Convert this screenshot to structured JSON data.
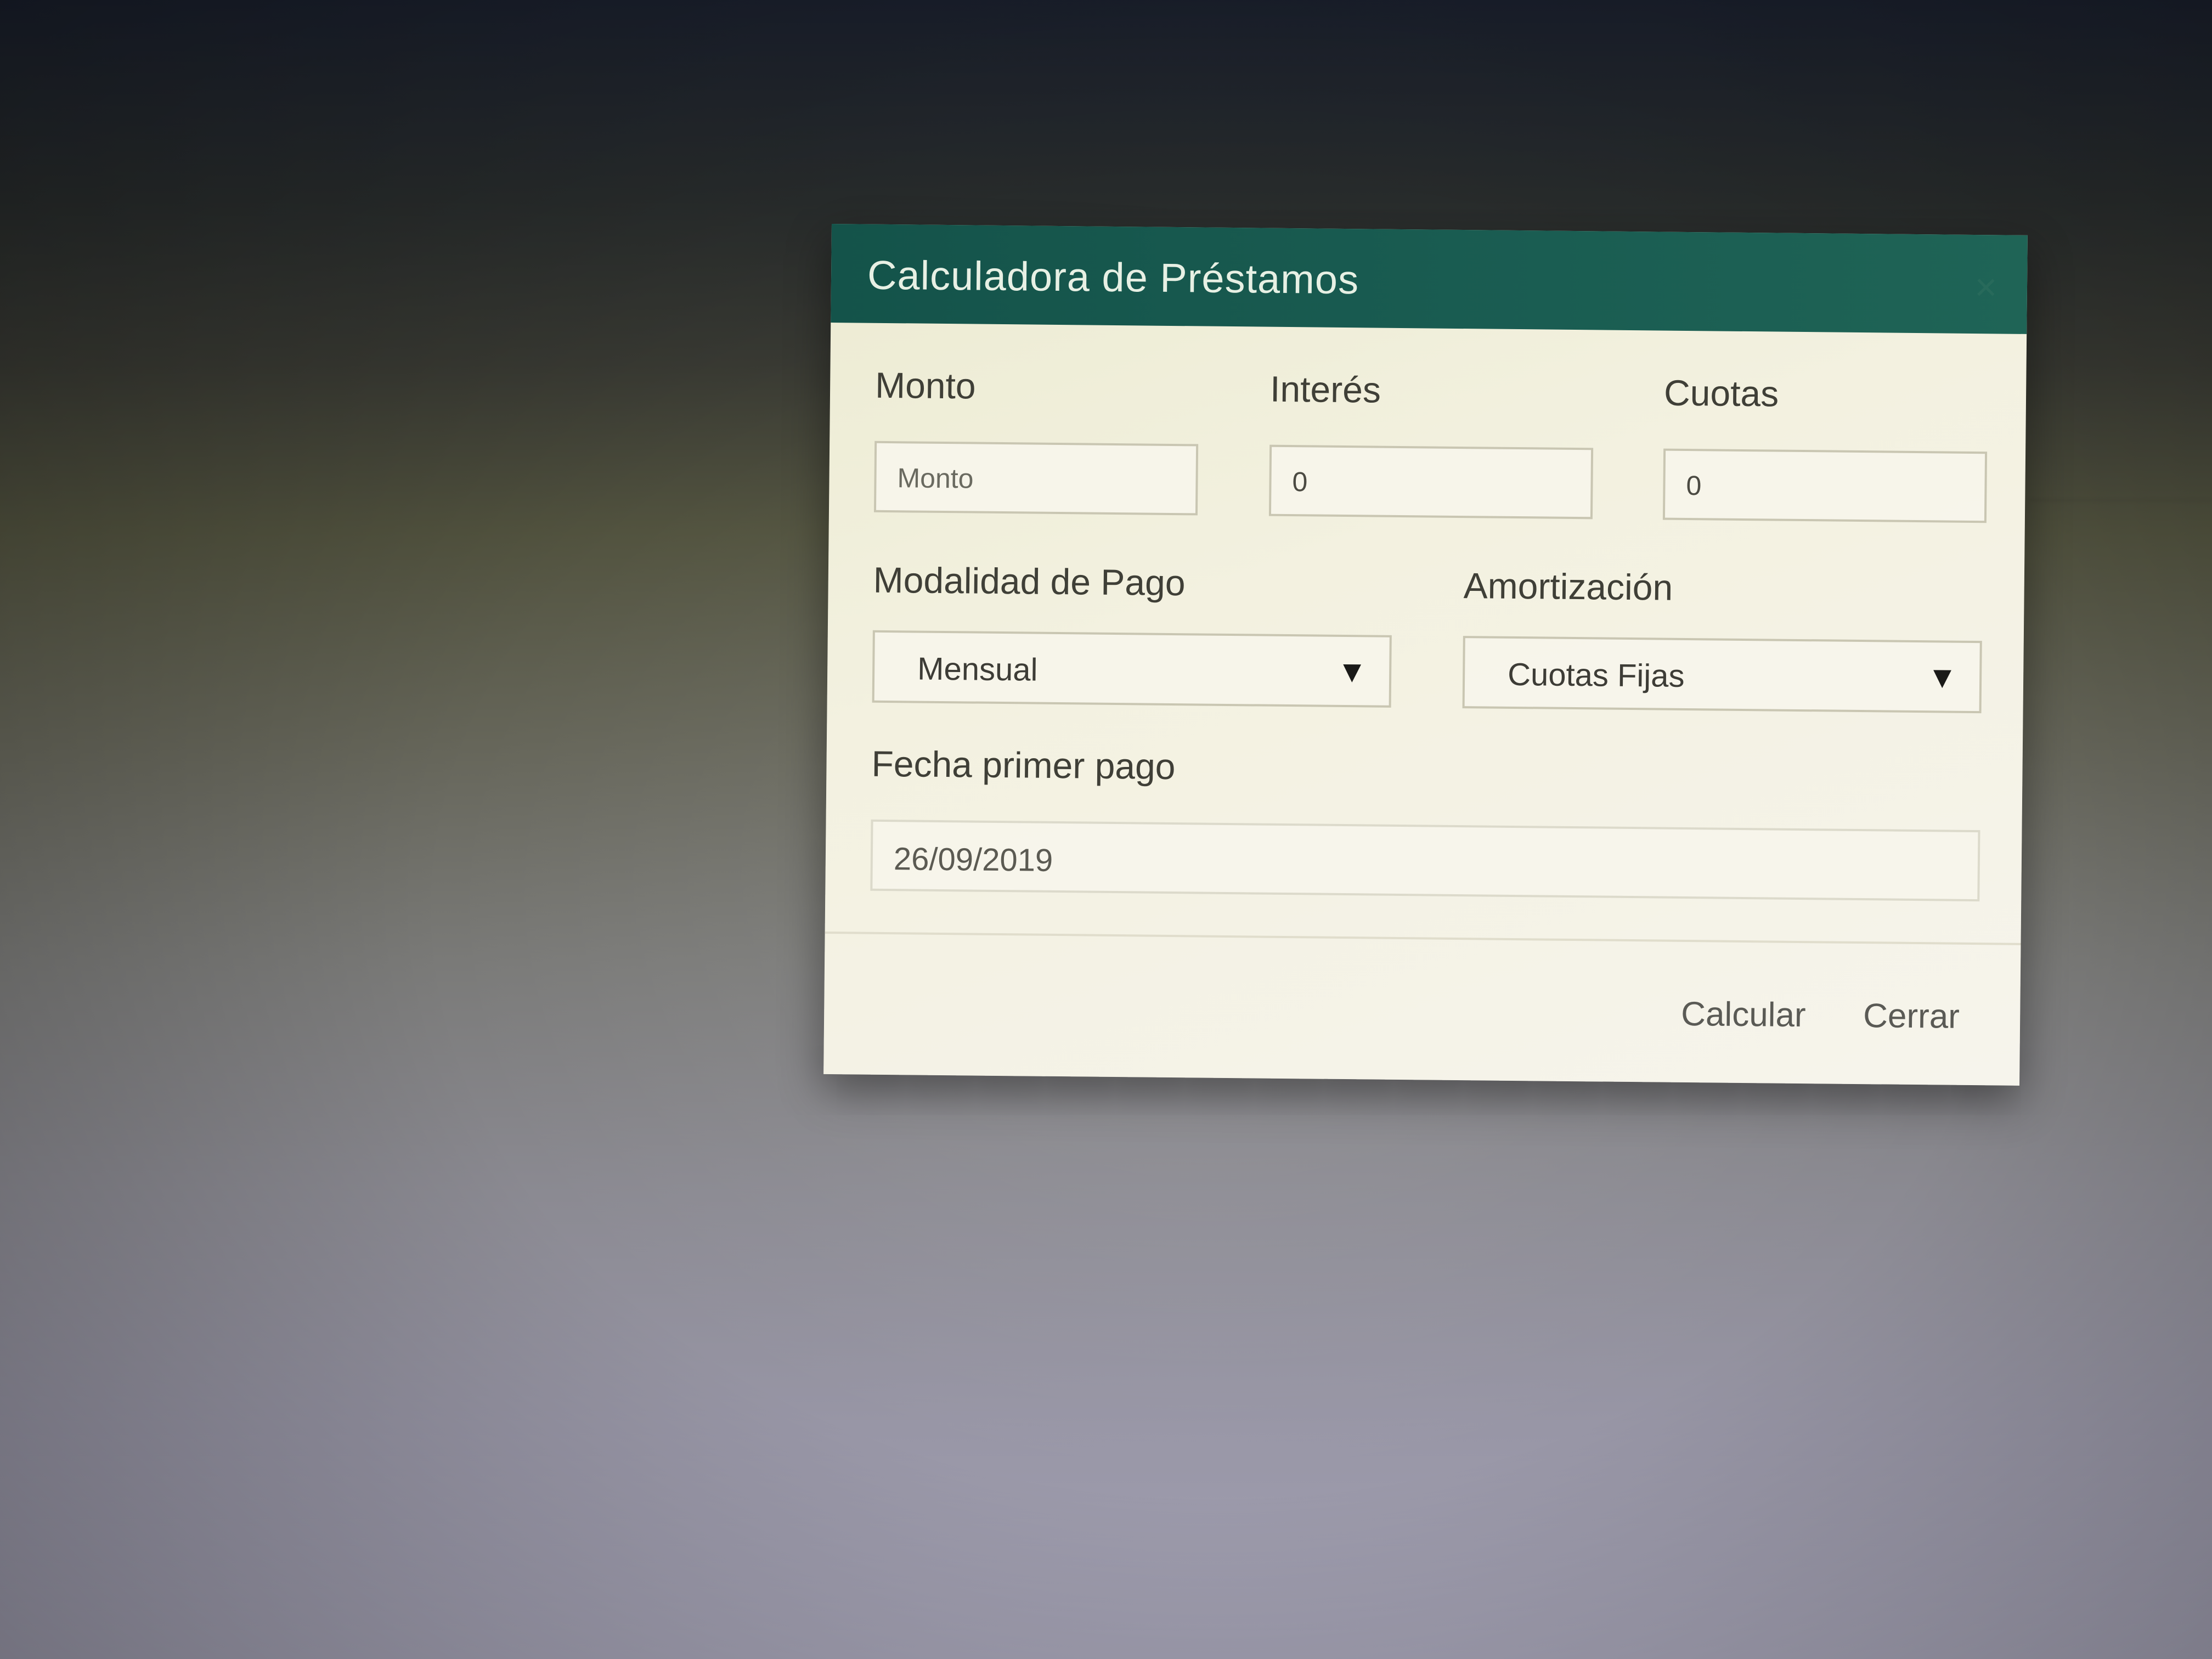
{
  "modal": {
    "title": "Calculadora de Préstamos",
    "close_icon": "close-icon"
  },
  "form": {
    "monto": {
      "label": "Monto",
      "placeholder": "Monto",
      "value": ""
    },
    "interes": {
      "label": "Interés",
      "value": "0"
    },
    "cuotas": {
      "label": "Cuotas",
      "value": "0"
    },
    "modalidad_pago": {
      "label": "Modalidad de Pago",
      "selected": "Mensual"
    },
    "amortizacion": {
      "label": "Amortización",
      "selected": "Cuotas Fijas"
    },
    "fecha_primer_pago": {
      "label": "Fecha primer pago",
      "value": "26/09/2019"
    }
  },
  "footer": {
    "calcular_label": "Calcular",
    "cerrar_label": "Cerrar"
  },
  "colors": {
    "header_bg": "#14534a",
    "header_text": "#e7f0e4",
    "modal_bg": "#f3f1e0"
  }
}
